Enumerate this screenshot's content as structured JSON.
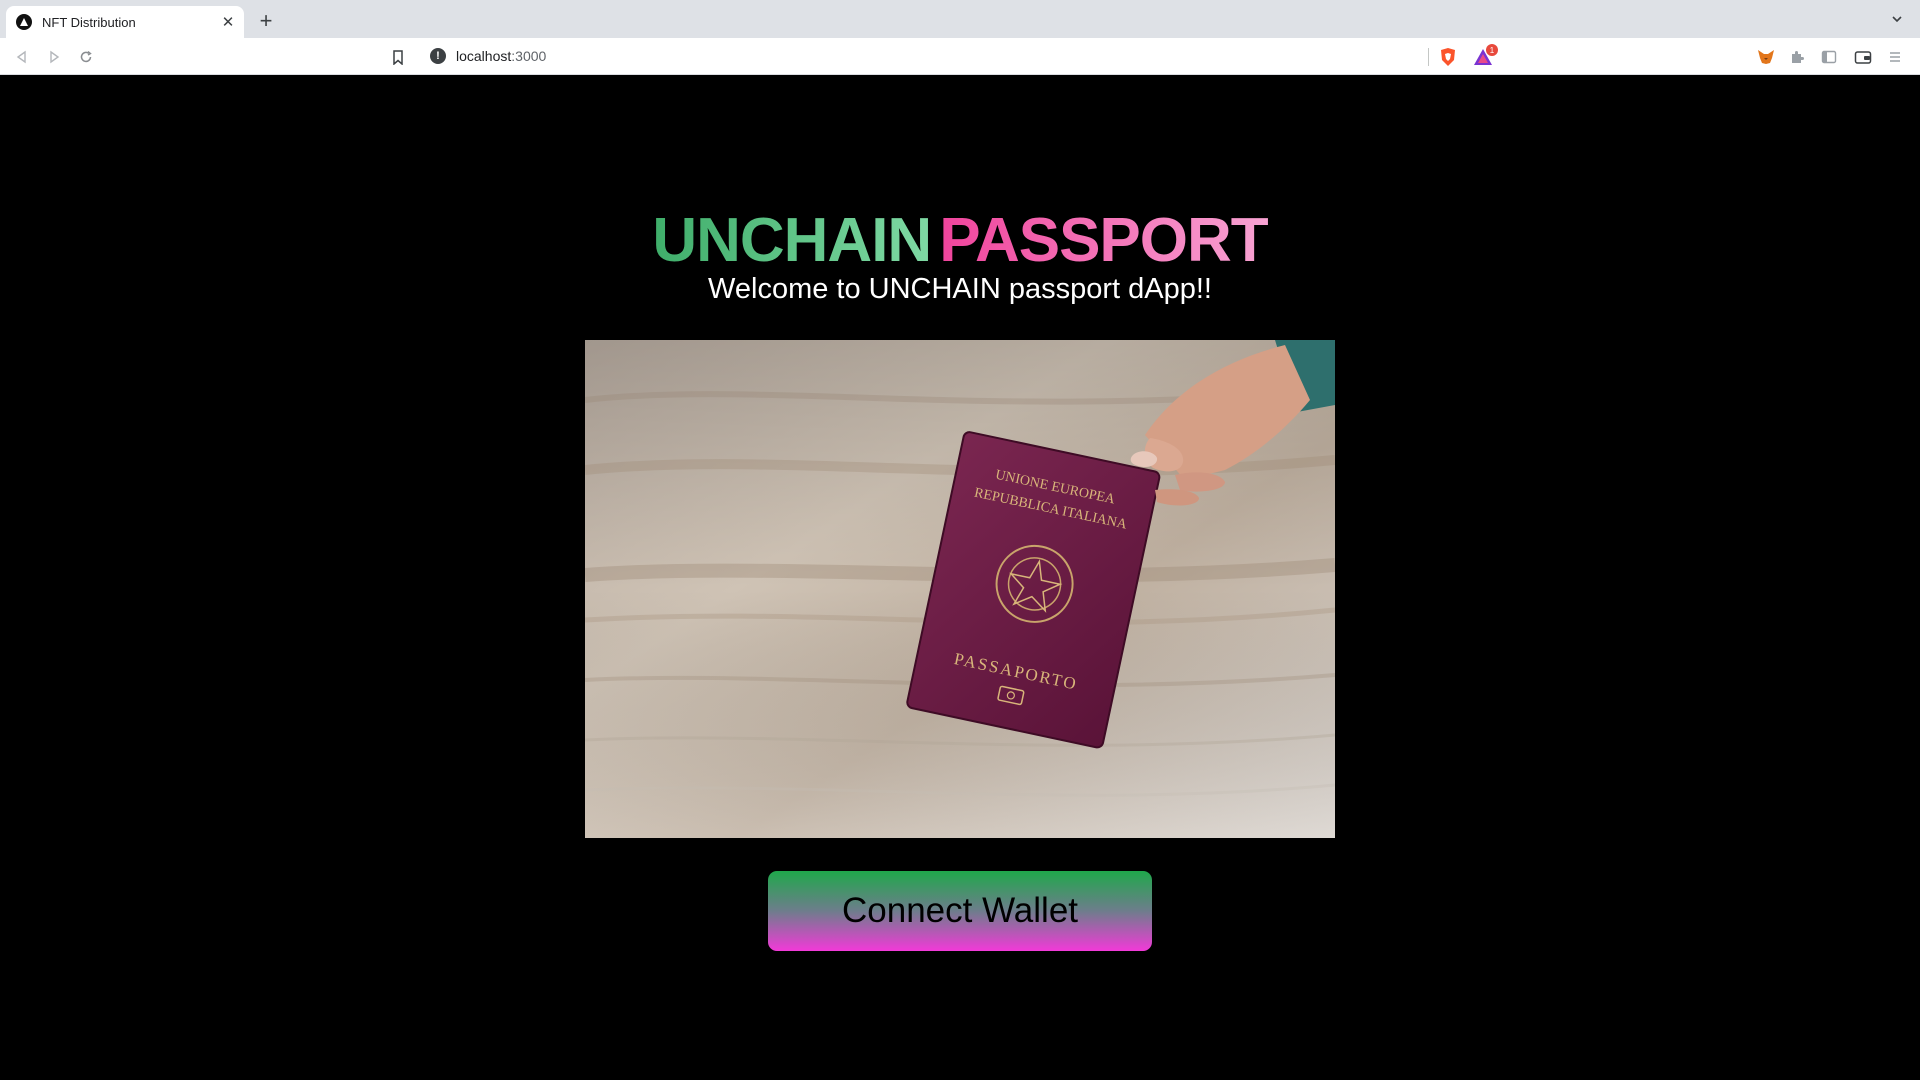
{
  "browser": {
    "tab_title": "NFT Distribution",
    "url_host": "localhost",
    "url_port": ":3000",
    "shield_badge": "1"
  },
  "hero": {
    "title_part1": "UNCHAIN",
    "title_part2": "PASSPORT",
    "subtitle": "Welcome to UNCHAIN passport dApp!!",
    "image_alt": "Hand holding an Italian passport",
    "passport_line1": "UNIONE EUROPEA",
    "passport_line2": "REPUBBLICA ITALIANA",
    "passport_word": "PASSAPORTO"
  },
  "actions": {
    "connect_label": "Connect Wallet"
  },
  "colors": {
    "title_green": "#3fae6a",
    "title_pink": "#f0449c",
    "button_top": "#1fa84b",
    "button_bottom": "#f23ad8"
  }
}
